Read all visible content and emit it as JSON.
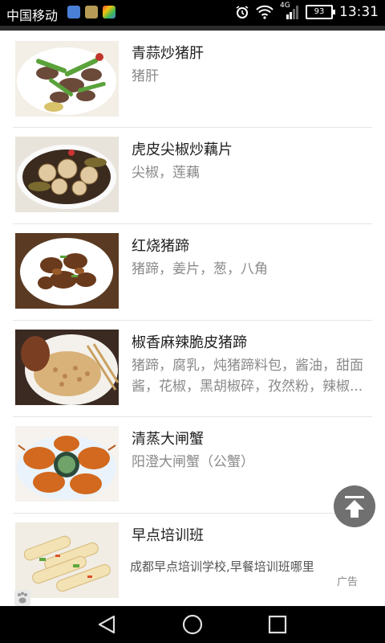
{
  "status_bar": {
    "carrier": "中国移动",
    "network": "4G",
    "battery": "93",
    "time": "13:31"
  },
  "list": {
    "items": [
      {
        "title": "青蒜炒猪肝",
        "subtitle": "猪肝"
      },
      {
        "title": "虎皮尖椒炒藕片",
        "subtitle": "尖椒，莲藕"
      },
      {
        "title": "红烧猪蹄",
        "subtitle": "猪蹄，姜片，葱，八角"
      },
      {
        "title": "椒香麻辣脆皮猪蹄",
        "subtitle": "猪蹄，腐乳，炖猪蹄料包，酱油，甜面酱，花椒，黑胡椒碎，孜然粉，辣椒..."
      },
      {
        "title": "清蒸大闸蟹",
        "subtitle": "阳澄大闸蟹（公蟹）"
      }
    ],
    "ad": {
      "title": "早点培训班",
      "text": "成都早点培训学校,早餐培训班哪里",
      "label": "广告"
    }
  },
  "icons": {
    "back_to_top": "arrow-up-to-top-icon",
    "paw": "paw-icon",
    "nav_back": "triangle-back-icon",
    "nav_home": "circle-home-icon",
    "nav_recent": "square-recent-icon"
  }
}
